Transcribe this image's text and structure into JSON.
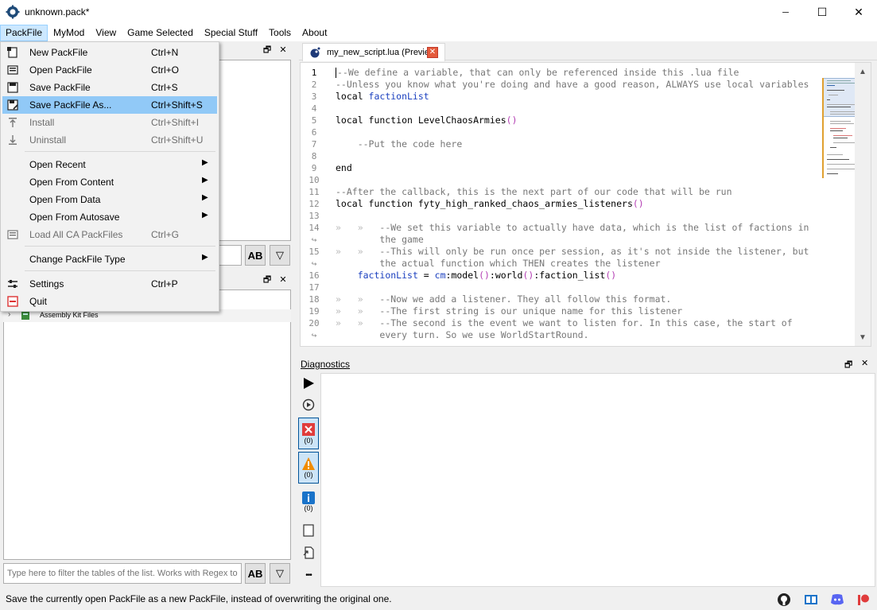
{
  "window": {
    "title": "unknown.pack*",
    "minimize_glyph": "─",
    "maximize_glyph": "☐",
    "close_glyph": "✕"
  },
  "menubar": [
    {
      "label": "PackFile"
    },
    {
      "label": "MyMod"
    },
    {
      "label": "View"
    },
    {
      "label": "Game Selected"
    },
    {
      "label": "Special Stuff"
    },
    {
      "label": "Tools"
    },
    {
      "label": "About"
    }
  ],
  "packfile_menu": {
    "items": [
      {
        "icon": "new-file-icon",
        "label": "New PackFile",
        "shortcut": "Ctrl+N"
      },
      {
        "icon": "open-file-icon",
        "label": "Open PackFile",
        "shortcut": "Ctrl+O"
      },
      {
        "icon": "save-icon",
        "label": "Save PackFile",
        "shortcut": "Ctrl+S"
      },
      {
        "icon": "save-as-icon",
        "label": "Save PackFile As...",
        "shortcut": "Ctrl+Shift+S",
        "highlighted": true
      },
      {
        "icon": "install-icon",
        "label": "Install",
        "shortcut": "Ctrl+Shift+I",
        "disabled": true
      },
      {
        "icon": "uninstall-icon",
        "label": "Uninstall",
        "shortcut": "Ctrl+Shift+U",
        "disabled": true
      },
      {
        "label": "Open Recent",
        "submenu": true
      },
      {
        "label": "Open From Content",
        "submenu": true
      },
      {
        "label": "Open From Data",
        "submenu": true
      },
      {
        "label": "Open From Autosave",
        "submenu": true
      },
      {
        "icon": "load-all-icon",
        "label": "Load All CA PackFiles",
        "shortcut": "Ctrl+G",
        "disabled": true
      },
      {
        "label": "Change PackFile Type",
        "submenu": true
      },
      {
        "icon": "settings-icon",
        "label": "Settings",
        "shortcut": "Ctrl+P"
      },
      {
        "icon": "quit-icon",
        "label": "Quit"
      }
    ],
    "submenu_arrow": "▶"
  },
  "left_panels": {
    "float_glyph": "🗗",
    "close_glyph": "✕",
    "tree_item": "Assembly Kit Files",
    "filter_placeholder": "Type here to filter the tables of the list. Works with Regex too!",
    "case_button": "AB",
    "dropdown_button": "▽"
  },
  "editor": {
    "tab_label": "my_new_script.lua (Preview)",
    "tab_close": "✕",
    "scroll_up": "▲",
    "scroll_down": "▼",
    "lines": [
      {
        "n": "1",
        "code": [
          {
            "t": "--We define a variable, that can only be referenced inside this .lua file",
            "c": "cm"
          }
        ]
      },
      {
        "n": "2",
        "code": [
          {
            "t": "--Unless you know what you're doing and have a good reason, ALWAYS use local variables",
            "c": "cm"
          }
        ]
      },
      {
        "n": "3",
        "code": [
          {
            "t": "local ",
            "c": "kw"
          },
          {
            "t": "factionList",
            "c": "id"
          }
        ]
      },
      {
        "n": "4",
        "code": []
      },
      {
        "n": "5",
        "code": [
          {
            "t": "local function LevelChaosArmies",
            "c": "kw"
          },
          {
            "t": "()",
            "c": "pn"
          }
        ]
      },
      {
        "n": "6",
        "code": []
      },
      {
        "n": "7",
        "code": [
          {
            "t": "    --Put the code here",
            "c": "cm"
          }
        ]
      },
      {
        "n": "8",
        "code": []
      },
      {
        "n": "9",
        "code": [
          {
            "t": "end",
            "c": "kw"
          }
        ]
      },
      {
        "n": "10",
        "code": []
      },
      {
        "n": "11",
        "code": [
          {
            "t": "--After the callback, this is the next part of our code that will be run",
            "c": "cm"
          }
        ]
      },
      {
        "n": "12",
        "code": [
          {
            "t": "local function fyty_high_ranked_chaos_armies_listeners",
            "c": "kw"
          },
          {
            "t": "()",
            "c": "pn"
          }
        ]
      },
      {
        "n": "13",
        "code": []
      },
      {
        "n": "14",
        "code": [
          {
            "t": "»   »   ",
            "c": "ws"
          },
          {
            "t": "--We set this variable to actually have data, which is the list of factions in",
            "c": "cm"
          }
        ]
      },
      {
        "n": "↪",
        "code": [
          {
            "t": "        ",
            "c": "ws"
          },
          {
            "t": "the game",
            "c": "cm"
          }
        ]
      },
      {
        "n": "15",
        "code": [
          {
            "t": "»   »   ",
            "c": "ws"
          },
          {
            "t": "--This will only be run once per session, as it's not inside the listener, but",
            "c": "cm"
          }
        ]
      },
      {
        "n": "↪",
        "code": [
          {
            "t": "        ",
            "c": "ws"
          },
          {
            "t": "the actual function which THEN creates the listener",
            "c": "cm"
          }
        ]
      },
      {
        "n": "16",
        "code": [
          {
            "t": "    ",
            "c": "ws"
          },
          {
            "t": "factionList",
            "c": "id"
          },
          {
            "t": " = ",
            "c": "kw"
          },
          {
            "t": "cm",
            "c": "id"
          },
          {
            "t": ":model",
            "c": "kw"
          },
          {
            "t": "()",
            "c": "pn"
          },
          {
            "t": ":world",
            "c": "kw"
          },
          {
            "t": "()",
            "c": "pn"
          },
          {
            "t": ":faction_list",
            "c": "kw"
          },
          {
            "t": "()",
            "c": "pn"
          }
        ]
      },
      {
        "n": "17",
        "code": []
      },
      {
        "n": "18",
        "code": [
          {
            "t": "»   »   ",
            "c": "ws"
          },
          {
            "t": "--Now we add a listener. They all follow this format.",
            "c": "cm"
          }
        ]
      },
      {
        "n": "19",
        "code": [
          {
            "t": "»   »   ",
            "c": "ws"
          },
          {
            "t": "--The first string is our unique name for this listener",
            "c": "cm"
          }
        ]
      },
      {
        "n": "20",
        "code": [
          {
            "t": "»   »   ",
            "c": "ws"
          },
          {
            "t": "--The second is the event we want to listen for. In this case, the start of",
            "c": "cm"
          }
        ]
      },
      {
        "n": "↪",
        "code": [
          {
            "t": "        ",
            "c": "ws"
          },
          {
            "t": "every turn. So we use WorldStartRound.",
            "c": "cm"
          }
        ]
      }
    ]
  },
  "diagnostics": {
    "title": "Diagnostics",
    "errors_count": "(0)",
    "warnings_count": "(0)",
    "info_count": "(0)",
    "more_glyph": "•••"
  },
  "statusbar": {
    "text": "Save the currently open PackFile as a new PackFile, instead of overwriting the original one."
  },
  "colors": {
    "highlight": "#91c9f7",
    "menu_active": "#cce8ff",
    "error_red": "#e03c3c",
    "warning_orange": "#f08c00",
    "info_blue": "#1a73c9"
  }
}
